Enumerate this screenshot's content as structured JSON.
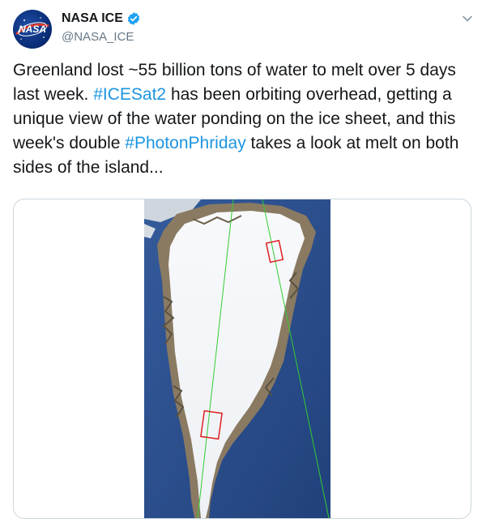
{
  "author": {
    "display_name": "NASA ICE",
    "handle": "@NASA_ICE",
    "avatar_text": "NASA",
    "verified": true
  },
  "tweet": {
    "text_1": "Greenland lost ~55 billion tons of water to melt over 5 days last week. ",
    "hashtag_1": "#ICESat2",
    "text_2": " has been orbiting overhead, getting a unique view of the water ponding on the ice sheet, and this week's double ",
    "hashtag_2": "#PhotonPhriday",
    "text_3": " takes a look at melt on both sides of the island..."
  },
  "icons": {
    "verified": "verified-badge-icon",
    "menu": "chevron-down-icon"
  },
  "colors": {
    "hashtag": "#1b95e0",
    "verified": "#1da1f2",
    "ocean": "#2a4e8c",
    "ice": "#f4f6f8",
    "track_line": "#33cc33",
    "highlight_box": "#e02020"
  }
}
